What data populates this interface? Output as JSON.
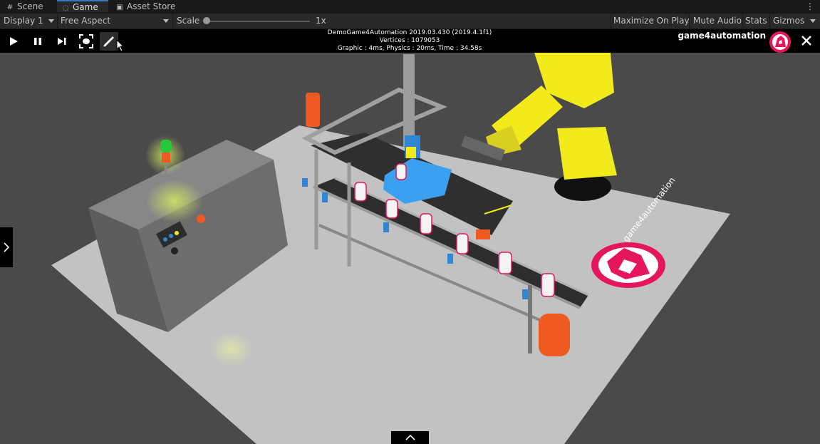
{
  "tabs": [
    {
      "label": "Scene",
      "icon": "grid-icon"
    },
    {
      "label": "Game",
      "icon": "gamepad-icon"
    },
    {
      "label": "Asset Store",
      "icon": "shopping-bag-icon"
    }
  ],
  "toolbar": {
    "display": "Display 1",
    "aspect": "Free Aspect",
    "scale_label": "Scale",
    "scale_value": "1x",
    "maximize": "Maximize On Play",
    "mute": "Mute Audio",
    "stats": "Stats",
    "gizmos": "Gizmos"
  },
  "hud": {
    "stats_line1": "DemoGame4Automation 2019.03.430 (2019.4.1f1)",
    "stats_line2": "Vertices : 1079053",
    "stats_line3": "Graphic : 4ms, Physics : 20ms, Time : 34.58s",
    "brand": "game4automation",
    "buttons": [
      "play-icon",
      "pause-icon",
      "step-icon",
      "focus-icon",
      "pin-icon",
      "close-icon"
    ]
  },
  "scene": {
    "floor_logo_text": "game4automation",
    "colors": {
      "background": "#4a4a4a",
      "floor": "#c4c4c4",
      "cabinet": "#6a6a6a",
      "robot": "#f2ea1a",
      "blue_parts": "#2f86d4",
      "orange_parts": "#ee5a20",
      "brand_pink": "#e6165a"
    }
  }
}
